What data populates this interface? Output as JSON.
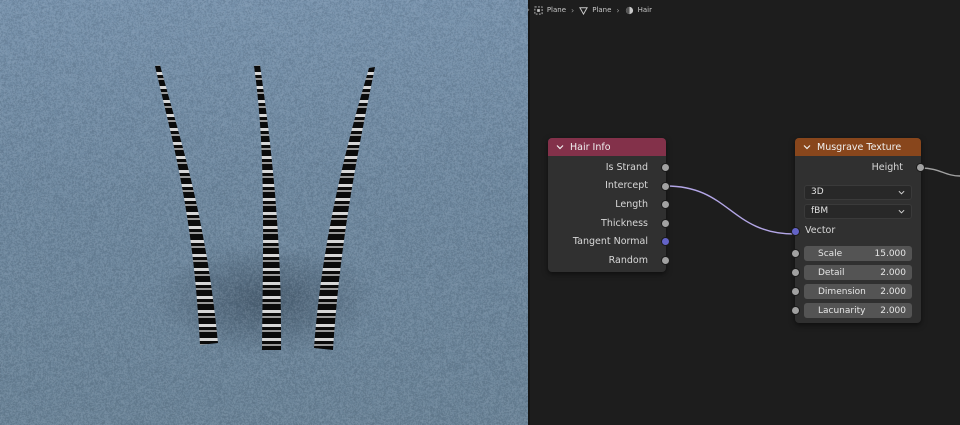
{
  "breadcrumb": {
    "items": [
      {
        "label": "Plane",
        "icon": "object-icon"
      },
      {
        "label": "Plane",
        "icon": "mesh-data-icon"
      },
      {
        "label": "Hair",
        "icon": "material-icon"
      }
    ]
  },
  "nodes": {
    "hair_info": {
      "title": "Hair Info",
      "header_color": "#83314a",
      "outputs": [
        {
          "label": "Is Strand",
          "socket_color": "#a1a1a1"
        },
        {
          "label": "Intercept",
          "socket_color": "#a1a1a1"
        },
        {
          "label": "Length",
          "socket_color": "#a1a1a1"
        },
        {
          "label": "Thickness",
          "socket_color": "#a1a1a1"
        },
        {
          "label": "Tangent Normal",
          "socket_color": "#6363c7"
        },
        {
          "label": "Random",
          "socket_color": "#a1a1a1"
        }
      ]
    },
    "musgrave": {
      "title": "Musgrave Texture",
      "header_color": "#88461c",
      "output": "Height",
      "dimensions": "3D",
      "type": "fBM",
      "vector_label": "Vector",
      "fields": [
        {
          "label": "Scale",
          "value": "15.000"
        },
        {
          "label": "Detail",
          "value": "2.000"
        },
        {
          "label": "Dimension",
          "value": "2.000"
        },
        {
          "label": "Lacunarity",
          "value": "2.000"
        }
      ]
    }
  },
  "colors": {
    "wire_intercept": "#b3a6e6",
    "wire_height": "#a1a1a1",
    "editor_background": "#1d1d1d",
    "viewport_background": "#7089a1"
  }
}
